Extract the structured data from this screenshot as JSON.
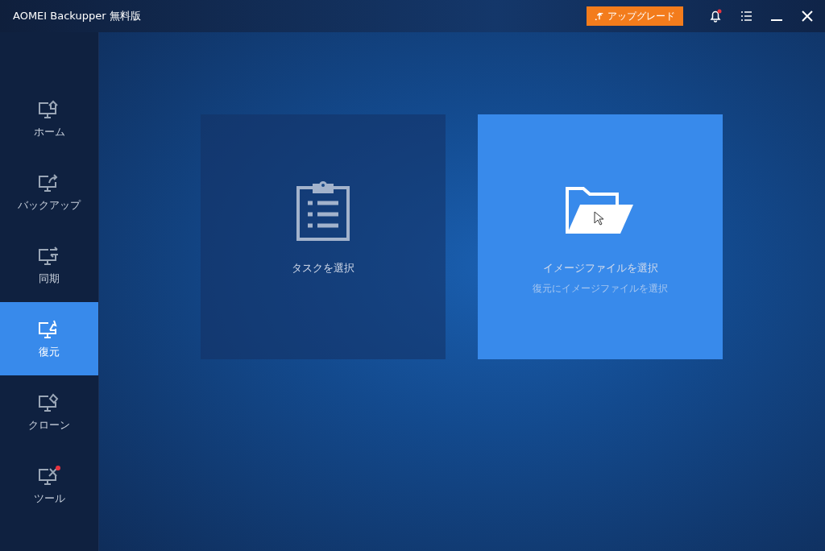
{
  "window": {
    "title": "AOMEI Backupper 無料版",
    "upgrade_button": "アップグレード",
    "notification": true
  },
  "sidebar": {
    "items": [
      {
        "kind": "home",
        "label": "ホーム",
        "selected": false,
        "badge": false
      },
      {
        "kind": "backup",
        "label": "バックアップ",
        "selected": false,
        "badge": false
      },
      {
        "kind": "sync",
        "label": "同期",
        "selected": false,
        "badge": false
      },
      {
        "kind": "restore",
        "label": "復元",
        "selected": true,
        "badge": false
      },
      {
        "kind": "clone",
        "label": "クローン",
        "selected": false,
        "badge": false
      },
      {
        "kind": "tools",
        "label": "ツール",
        "selected": false,
        "badge": true
      }
    ]
  },
  "cards": [
    {
      "kind": "task",
      "title": "タスクを選択",
      "selected": false
    },
    {
      "kind": "image",
      "title": "イメージファイルを選択",
      "subtitle": "復元にイメージファイルを選択",
      "selected": true
    }
  ]
}
